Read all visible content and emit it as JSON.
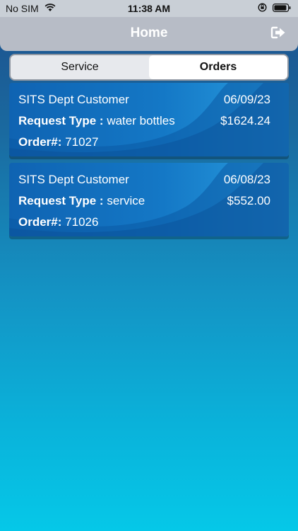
{
  "status_bar": {
    "carrier": "No SIM",
    "time": "11:38 AM"
  },
  "header": {
    "title": "Home",
    "logout_icon": "logout-icon"
  },
  "tabs": [
    {
      "label": "Service",
      "selected": false
    },
    {
      "label": "Orders",
      "selected": true
    }
  ],
  "orders": [
    {
      "customer": "SITS Dept Customer",
      "date": "06/09/23",
      "request_label": "Request Type :",
      "request_type": "water bottles",
      "amount": "$1624.24",
      "order_label": "Order#:",
      "order_number": "71027"
    },
    {
      "customer": "SITS Dept Customer",
      "date": "06/08/23",
      "request_label": "Request Type :",
      "request_type": "service",
      "amount": "$552.00",
      "order_label": "Order#:",
      "order_number": "71026"
    }
  ],
  "colors": {
    "header_bg": "#b7bcc6",
    "card_blue": "#1478c6",
    "background_top": "#1d4f8c",
    "background_bottom": "#05c8e8"
  }
}
